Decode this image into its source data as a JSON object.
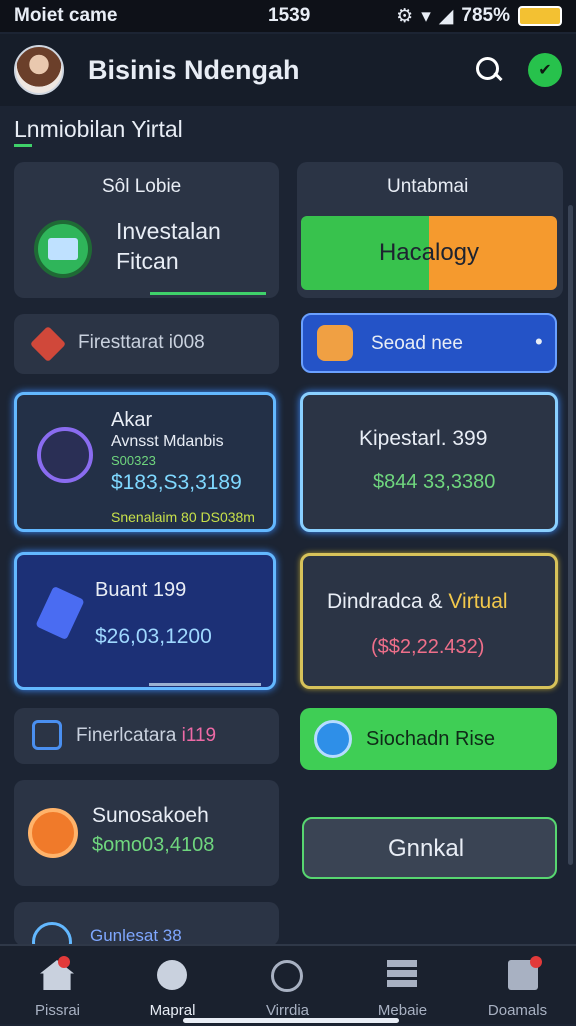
{
  "status": {
    "carrier": "Moiet came",
    "time": "1539",
    "battery": "785%"
  },
  "header": {
    "title": "Bisinis Ndengah",
    "badge": "✔"
  },
  "section": {
    "title": "Lnmiobilan Yirtal"
  },
  "cards": {
    "invest": {
      "top": "Sôl Lobie",
      "line1": "Investalan",
      "line2": "Fitcan"
    },
    "unta": {
      "title": "Untabmai",
      "button": "Hacalogy"
    },
    "first": {
      "text": "Firesttarat i008"
    },
    "second": {
      "text": "Seoad nee",
      "dot": "•"
    },
    "akar": {
      "title": "Akar",
      "sub": "Avnsst Mdanbis",
      "code": "S00323",
      "amount": "$183,S3,3189",
      "footer": "Snenalaim 80 DS038m"
    },
    "kip": {
      "title": "Kipestarl. 399",
      "amount": "$844 33,3380"
    },
    "buant": {
      "title": "Buant 199",
      "amount": "$26,03,1200"
    },
    "dindra": {
      "title_a": "Dindradca & ",
      "title_b": "Virtual",
      "amount": "($$2,22.432)"
    },
    "fine": {
      "text_a": "Finerlcatara ",
      "text_b": "i119"
    },
    "sioch": {
      "button": "Siochadn Rise"
    },
    "suno": {
      "title": "Sunosakoeh",
      "amount": "$omo03,4108"
    },
    "gnnkal": {
      "button": "Gnnkal"
    },
    "partial": {
      "text": "Gunlesat 38"
    }
  },
  "nav": [
    {
      "label": "Pissrai",
      "icon": "home-icon",
      "dot": true
    },
    {
      "label": "Mapral",
      "icon": "chat-icon",
      "dot": false
    },
    {
      "label": "Virrdia",
      "icon": "compass-icon",
      "dot": false
    },
    {
      "label": "Mebaie",
      "icon": "stack-icon",
      "dot": false
    },
    {
      "label": "Doamals",
      "icon": "gift-icon",
      "dot": true
    }
  ],
  "colors": {
    "accent_green": "#3fd16a",
    "neon_blue": "#63b8ff",
    "orange": "#f59a2e"
  }
}
